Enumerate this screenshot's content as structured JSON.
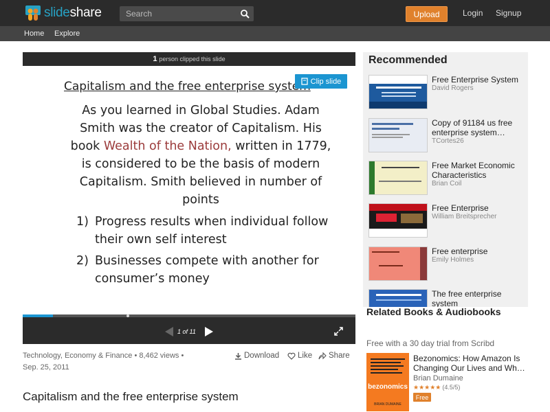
{
  "header": {
    "logo_slide": "slide",
    "logo_share": "share",
    "search_placeholder": "Search",
    "upload_label": "Upload",
    "login_label": "Login",
    "signup_label": "Signup"
  },
  "subnav": {
    "home_label": "Home",
    "explore_label": "Explore"
  },
  "slide": {
    "clip_count": "1",
    "clip_text": "person clipped this slide",
    "clip_button_label": "Clip slide",
    "title": "Capitalism and the free enterprise system",
    "body_part1": "As you learned in Global Studies. Adam Smith was the creator of Capitalism. His book ",
    "body_highlight": "Wealth of the Nation,",
    "body_part2": " written in 1779, is considered to be the basis of modern Capitalism. Smith believed in number of points",
    "points": [
      {
        "num": "1)",
        "text": "Progress results when individual follow their own self interest"
      },
      {
        "num": "2)",
        "text": "Businesses compete with another for consumer’s money"
      }
    ],
    "page_counter": "1 of 11",
    "progress_fraction": 0.09
  },
  "meta": {
    "categories": "Technology, Economy & Finance • 8,462 views •",
    "date": "Sep. 25, 2011",
    "download_label": "Download",
    "like_label": "Like",
    "share_label": "Share"
  },
  "document_title": "Capitalism and the free enterprise system",
  "recommended": {
    "heading": "Recommended",
    "items": [
      {
        "title": "Free Enterprise System",
        "author": "David Rogers"
      },
      {
        "title": "Copy of 91184 us free enterprise system…",
        "author": "TCortes26"
      },
      {
        "title": "Free Market Economic Characteristics",
        "author": "Brian Coil"
      },
      {
        "title": "Free Enterprise",
        "author": "William Breitsprecher"
      },
      {
        "title": "Free enterprise",
        "author": "Emily Holmes"
      },
      {
        "title": "The free enterprise system",
        "author": ""
      }
    ]
  },
  "related": {
    "heading": "Related Books & Audiobooks",
    "subheading": "Free with a 30 day trial from Scribd",
    "book": {
      "title": "Bezonomics: How Amazon Is Changing Our Lives and Wh…",
      "author": "Brian Dumaine",
      "stars": "★★★★★",
      "rating": "(4.5/5)",
      "badge": "Free",
      "cover_word": "bezonomics",
      "cover_author": "BRIAN DUMAINE"
    }
  },
  "colors": {
    "accent_blue": "#1b95d1",
    "upload_orange": "#e0812c",
    "header_bg": "#2b2b2b"
  }
}
